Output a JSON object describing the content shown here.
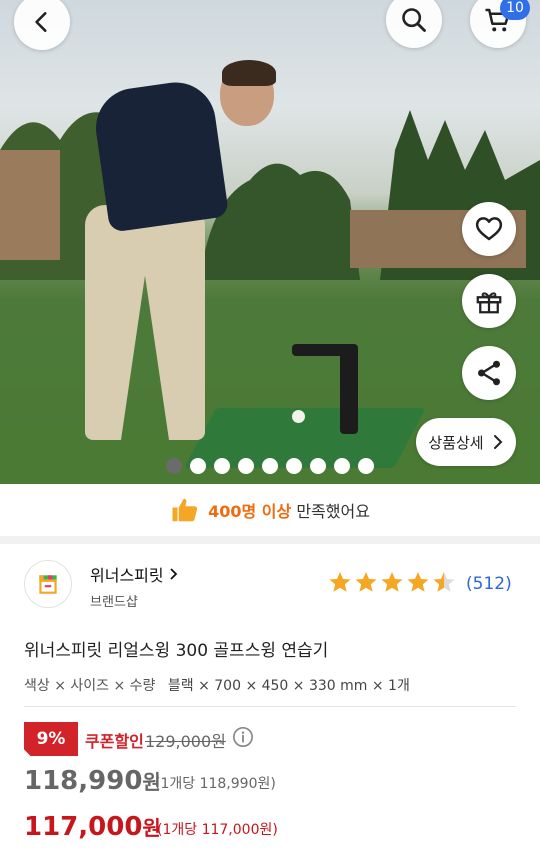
{
  "header": {
    "back_icon": "chevron-left-icon",
    "search_icon": "search-icon",
    "cart_icon": "cart-icon",
    "cart_count": "10"
  },
  "hero": {
    "detail_button_label": "상품상세",
    "carousel_total": 9,
    "carousel_active": 0
  },
  "satisfaction": {
    "count_text": "400명 이상",
    "suffix": "만족했어요"
  },
  "store": {
    "name": "위너스피릿",
    "type": "브랜드샵",
    "rating": 4.5,
    "review_count": "(512)"
  },
  "product": {
    "name": "위너스피릿 리얼스윙 300 골프스윙 연습기",
    "option_label": "색상 × 사이즈 × 수량",
    "option_value": "블랙 × 700 × 450 × 330 mm × 1개"
  },
  "pricing": {
    "discount_rate": "9%",
    "coupon_label": "쿠폰할인",
    "original_price": "129,000원",
    "price_1": "118,990",
    "price_1_unit": "(1개당 118,990원)",
    "price_2": "117,000",
    "price_2_unit": "(1개당 117,000원)",
    "won": "원"
  },
  "colors": {
    "accent_red": "#d2232a",
    "accent_blue": "#2d66d8",
    "star": "#f5a623",
    "highlight_orange": "#f06b0f"
  }
}
